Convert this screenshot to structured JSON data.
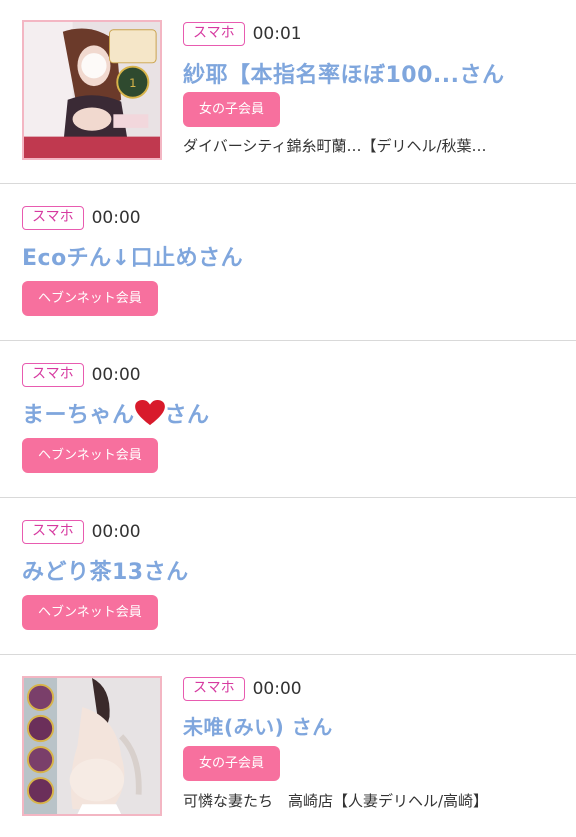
{
  "items": [
    {
      "device": "スマホ",
      "time": "00:01",
      "name": "紗耶【本指名率ほぼ100...さん",
      "member": "女の子会員",
      "shop": "ダイバーシティ錦糸町蘭…【デリヘル/秋葉…",
      "thumb": "profile-photo"
    },
    {
      "device": "スマホ",
      "time": "00:00",
      "name": "Ecoチん↓口止めさん",
      "member": "ヘブンネット会員"
    },
    {
      "device": "スマホ",
      "time": "00:00",
      "name_before": "まーちゃん",
      "name_icon": "red-heart-icon",
      "name_after": "さん",
      "member": "ヘブンネット会員"
    },
    {
      "device": "スマホ",
      "time": "00:00",
      "name": "みどり茶13さん",
      "member": "ヘブンネット会員"
    },
    {
      "device": "スマホ",
      "time": "00:00",
      "name": "未唯(みい) さん",
      "member": "女の子会員",
      "shop": "可憐な妻たち　高崎店【人妻デリヘル/高崎】",
      "thumb": "profile-photo"
    }
  ],
  "colors": {
    "name": "#7fa6dd",
    "badge_border": "#e85bb0",
    "member_button": "#f7709e",
    "strip": "#fde3e6"
  }
}
